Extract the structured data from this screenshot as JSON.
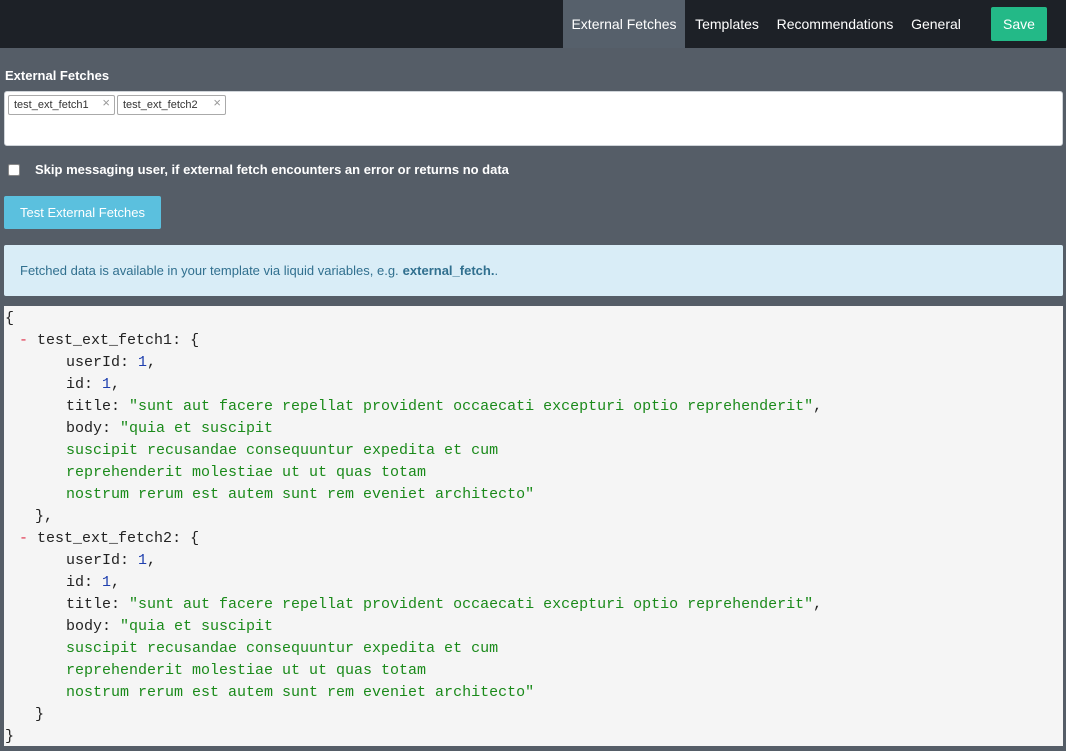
{
  "nav": {
    "items": [
      "External Fetches",
      "Templates",
      "Recommendations",
      "General"
    ],
    "active": "External Fetches",
    "save_label": "Save"
  },
  "section_label": "External Fetches",
  "tags": [
    "test_ext_fetch1",
    "test_ext_fetch2"
  ],
  "tag_remove_glyph": "×",
  "skip_label": "Skip messaging user, if external fetch encounters an error or returns no data",
  "test_button_label": "Test External Fetches",
  "info": {
    "text": "Fetched data is available in your template via liquid variables, e.g.",
    "code_ref": "external_fetch.",
    "suffix": " ."
  },
  "fetch_results": [
    {
      "name": "test_ext_fetch1",
      "userId": "1",
      "id": "1",
      "title": "\"sunt aut facere repellat provident occaecati excepturi optio reprehenderit\"",
      "body_lines": [
        "\"quia et suscipit",
        "suscipit recusandae consequuntur expedita et cum",
        "reprehenderit molestiae ut ut quas totam",
        "nostrum rerum est autem sunt rem eveniet architecto\""
      ]
    },
    {
      "name": "test_ext_fetch2",
      "userId": "1",
      "id": "1",
      "title": "\"sunt aut facere repellat provident occaecati excepturi optio reprehenderit\"",
      "body_lines": [
        "\"quia et suscipit",
        "suscipit recusandae consequuntur expedita et cum",
        "reprehenderit molestiae ut ut quas totam",
        "nostrum rerum est autem sunt rem eveniet architecto\""
      ]
    }
  ],
  "colors": {
    "topbar": "#1d2127",
    "page_bg": "#555d67",
    "active_nav": "#56606b",
    "save": "#23b987",
    "test_button": "#5bc0de",
    "info_bg": "#d9edf7",
    "info_text": "#31708f",
    "string": "#1a8a1a",
    "number": "#1f3fae",
    "collapse": "#e0314b"
  }
}
